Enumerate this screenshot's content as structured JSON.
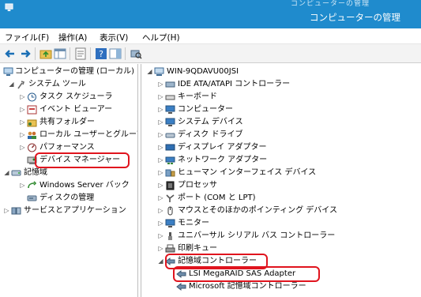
{
  "window": {
    "title": "コンピューターの管理",
    "cut_text": "コンピューターの管理"
  },
  "menu": [
    {
      "id": "file",
      "label": "ファイル(F)"
    },
    {
      "id": "action",
      "label": "操作(A)"
    },
    {
      "id": "view",
      "label": "表示(V)"
    },
    {
      "id": "help",
      "label": "ヘルプ(H)"
    }
  ],
  "toolbar": {
    "icons": [
      "back-arrow-icon",
      "forward-arrow-icon",
      "up-folder-icon",
      "show-tree-icon",
      "properties-icon",
      "help-icon",
      "action-pane-icon",
      "scan-hardware-icon"
    ]
  },
  "left_tree": [
    {
      "label": "コンピューターの管理 (ローカル)",
      "arrow": "",
      "icon": "computer-management-icon"
    },
    {
      "label": "システム ツール",
      "arrow": "◢",
      "icon": "tools-icon"
    },
    {
      "label": "タスク スケジューラ",
      "arrow": "▷",
      "icon": "clock-icon"
    },
    {
      "label": "イベント ビューアー",
      "arrow": "▷",
      "icon": "event-viewer-icon"
    },
    {
      "label": "共有フォルダー",
      "arrow": "▷",
      "icon": "shared-folder-icon"
    },
    {
      "label": "ローカル ユーザーとグループ",
      "arrow": "▷",
      "icon": "users-icon"
    },
    {
      "label": "パフォーマンス",
      "arrow": "▷",
      "icon": "performance-icon"
    },
    {
      "label": "デバイス マネージャー",
      "arrow": "",
      "icon": "device-manager-icon"
    },
    {
      "label": "記憶域",
      "arrow": "◢",
      "icon": "storage-icon"
    },
    {
      "label": "Windows Server バック",
      "arrow": "▷",
      "icon": "backup-icon"
    },
    {
      "label": "ディスクの管理",
      "arrow": "",
      "icon": "disk-management-icon"
    },
    {
      "label": "サービスとアプリケーション",
      "arrow": "▷",
      "icon": "services-icon"
    }
  ],
  "right_tree": [
    {
      "label": "WIN-9QDAVU00JSI",
      "arrow": "◢",
      "icon": "computer-icon"
    },
    {
      "label": "IDE ATA/ATAPI コントローラー",
      "arrow": "▷",
      "icon": "ide-controller-icon"
    },
    {
      "label": "キーボード",
      "arrow": "▷",
      "icon": "keyboard-icon"
    },
    {
      "label": "コンピューター",
      "arrow": "▷",
      "icon": "monitor-icon"
    },
    {
      "label": "システム デバイス",
      "arrow": "▷",
      "icon": "system-device-icon"
    },
    {
      "label": "ディスク ドライブ",
      "arrow": "▷",
      "icon": "disk-drive-icon"
    },
    {
      "label": "ディスプレイ アダプター",
      "arrow": "▷",
      "icon": "display-adapter-icon"
    },
    {
      "label": "ネットワーク アダプター",
      "arrow": "▷",
      "icon": "network-adapter-icon"
    },
    {
      "label": "ヒューマン インターフェイス デバイス",
      "arrow": "▷",
      "icon": "hid-icon"
    },
    {
      "label": "プロセッサ",
      "arrow": "▷",
      "icon": "processor-icon"
    },
    {
      "label": "ポート (COM と LPT)",
      "arrow": "▷",
      "icon": "port-icon"
    },
    {
      "label": "マウスとそのほかのポインティング デバイス",
      "arrow": "▷",
      "icon": "mouse-icon"
    },
    {
      "label": "モニター",
      "arrow": "▷",
      "icon": "monitor-icon"
    },
    {
      "label": "ユニバーサル シリアル バス コントローラー",
      "arrow": "▷",
      "icon": "usb-icon"
    },
    {
      "label": "印刷キュー",
      "arrow": "▷",
      "icon": "printer-icon"
    },
    {
      "label": "記憶域コントローラー",
      "arrow": "◢",
      "icon": "storage-controller-icon"
    },
    {
      "label": "LSI MegaRAID SAS Adapter",
      "arrow": "",
      "icon": "storage-controller-icon"
    },
    {
      "label": "Microsoft 記憶域コントローラー",
      "arrow": "",
      "icon": "storage-controller-icon"
    }
  ],
  "highlight_color": "#e0141e"
}
